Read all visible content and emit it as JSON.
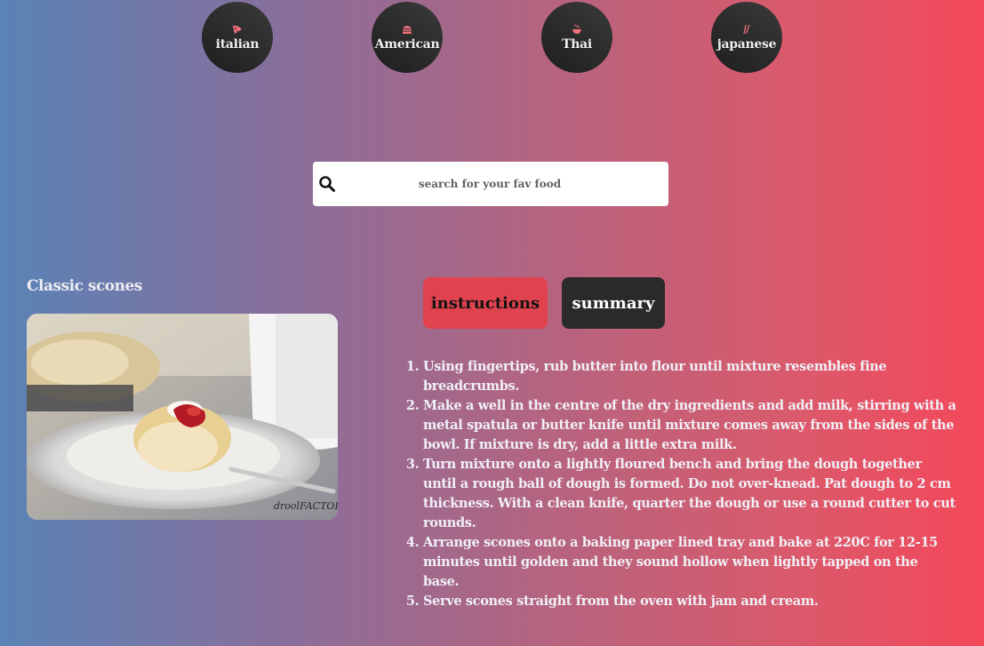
{
  "categories": [
    {
      "label": "italian",
      "icon": "pizza-icon"
    },
    {
      "label": "American",
      "icon": "burger-icon"
    },
    {
      "label": "Thai",
      "icon": "noodle-bowl-icon"
    },
    {
      "label": "japanese",
      "icon": "chopsticks-icon"
    }
  ],
  "search": {
    "placeholder": "search for your fav food",
    "icon": "search-icon"
  },
  "recipe": {
    "title": "Classic scones",
    "image_watermark": "droolFACTOR"
  },
  "tabs": {
    "instructions": "instructions",
    "summary": "summary"
  },
  "active_tab": "instructions",
  "colors": {
    "active_tab": "#e0434e",
    "inactive_tab": "#2a2a2a",
    "category_circle": "#2a2a2a"
  },
  "instructions": [
    "Using fingertips, rub butter into flour until mixture resembles fine breadcrumbs.",
    "Make a well in the centre of the dry ingredients and add milk, stirring with a metal spatula or butter knife until mixture comes away from the sides of the bowl. If mixture is dry, add a little extra milk.",
    "Turn mixture onto a lightly floured bench and bring the dough together until a rough ball of dough is formed. Do not over-knead. Pat dough to 2 cm thickness. With a clean knife, quarter the dough or use a round cutter to cut rounds.",
    "Arrange scones onto a baking paper lined tray and bake at 220C for 12-15 minutes until golden and they sound hollow when lightly tapped on the base.",
    "Serve scones straight from the oven with jam and cream."
  ]
}
